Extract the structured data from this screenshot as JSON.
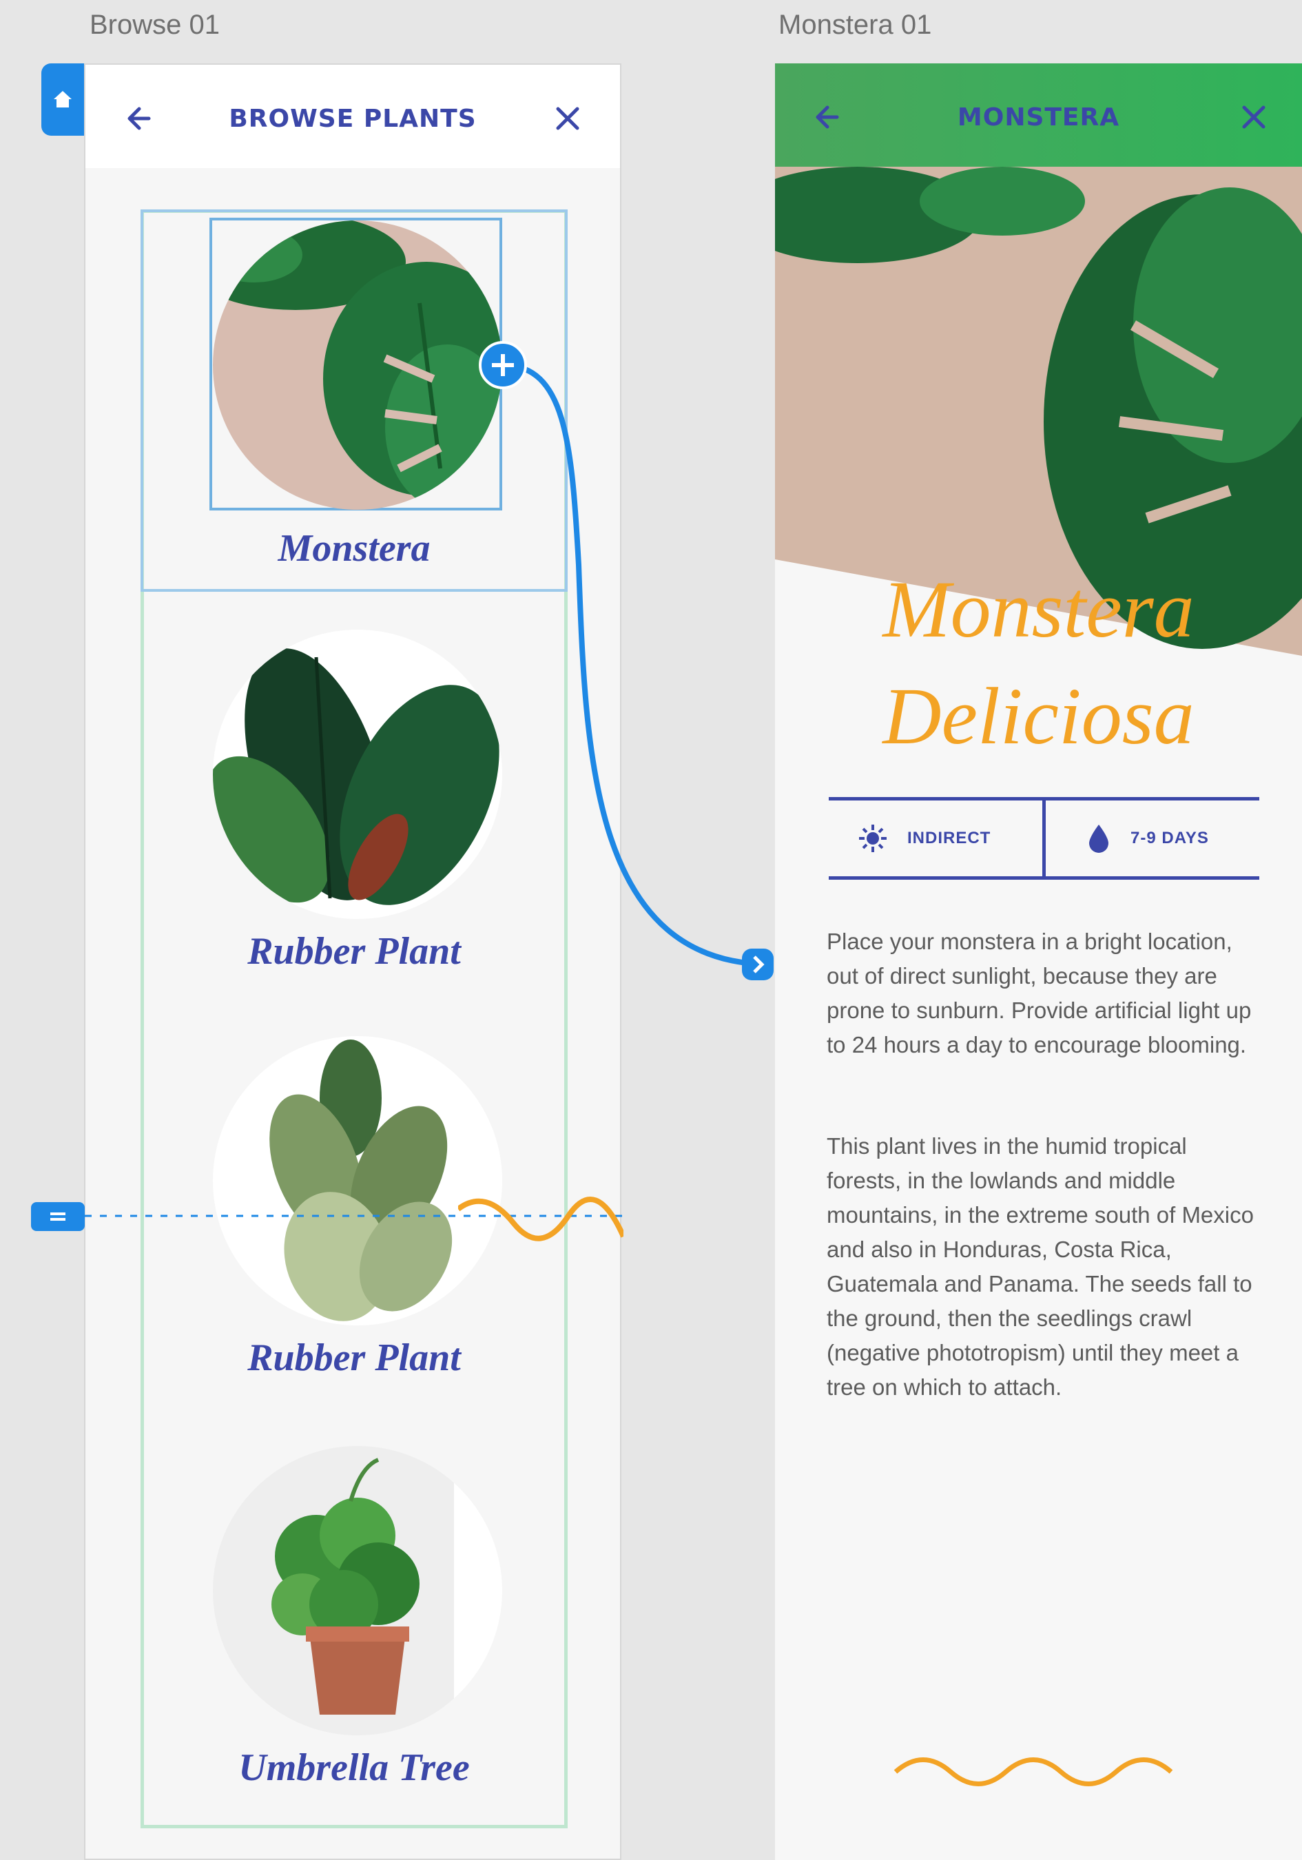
{
  "artboards": {
    "left_title": "Browse 01",
    "right_title": "Monstera 01"
  },
  "browse": {
    "header_title": "BROWSE PLANTS",
    "plants": [
      {
        "name": "Monstera"
      },
      {
        "name": "Rubber Plant"
      },
      {
        "name": "Rubber Plant"
      },
      {
        "name": "Umbrella Tree"
      }
    ]
  },
  "detail": {
    "header_title": "MONSTERA",
    "title_line1": "Monstera",
    "title_line2": "Deliciosa",
    "light_label": "INDIRECT",
    "water_label": "7-9 DAYS",
    "paragraph1": "Place your monstera in a bright location, out of direct sunlight, because they are prone to sunburn. Provide artificial light up to 24 hours a day to encourage blooming.",
    "paragraph2": "This plant lives in the humid tropical forests, in the lowlands and middle mountains, in the extreme south of Mexico and also in Honduras, Costa Rica, Guatemala and Panama. The seeds fall to the ground, then the seedlings crawl (negative phototropism) until they meet a tree on which to attach."
  },
  "colors": {
    "accent_blue": "#3b47a8",
    "accent_orange": "#f3a325",
    "wire_blue": "#1e88e5",
    "grid_green": "#bfe6cf"
  },
  "icons": [
    "home-icon",
    "back-arrow-icon",
    "close-icon",
    "plus-icon",
    "arrow-right-icon",
    "sun-icon",
    "water-drop-icon",
    "scroll-handle-icon",
    "wave-icon"
  ]
}
